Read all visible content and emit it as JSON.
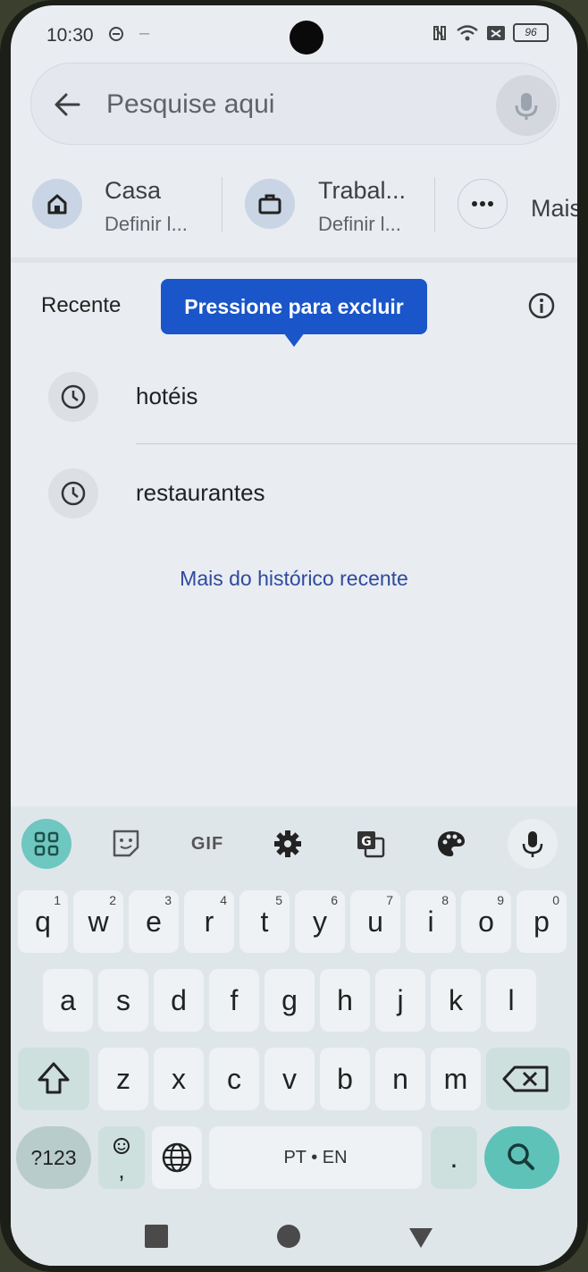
{
  "status_bar": {
    "time": "10:30",
    "battery": "96"
  },
  "search": {
    "placeholder": "Pesquise aqui"
  },
  "shortcuts": [
    {
      "title": "Casa",
      "subtitle": "Definir l..."
    },
    {
      "title": "Trabal...",
      "subtitle": "Definir l..."
    },
    {
      "title": "Mais",
      "subtitle": ""
    }
  ],
  "recent": {
    "label": "Recente",
    "tooltip": "Pressione para excluir",
    "items": [
      "hotéis",
      "restaurantes"
    ],
    "more_link": "Mais do histórico recente"
  },
  "keyboard": {
    "toolbar": {
      "gif": "GIF"
    },
    "row1": [
      "q",
      "w",
      "e",
      "r",
      "t",
      "y",
      "u",
      "i",
      "o",
      "p"
    ],
    "row1_hints": [
      "1",
      "2",
      "3",
      "4",
      "5",
      "6",
      "7",
      "8",
      "9",
      "0"
    ],
    "row2": [
      "a",
      "s",
      "d",
      "f",
      "g",
      "h",
      "j",
      "k",
      "l"
    ],
    "row3": [
      "z",
      "x",
      "c",
      "v",
      "b",
      "n",
      "m"
    ],
    "numsym": "?123",
    "emoji_comma": ",",
    "space": "PT • EN",
    "period": "."
  },
  "colors": {
    "tooltip": "#1a56c9",
    "link": "#2e4a9e",
    "keyboard_accent": "#5fc2b8"
  }
}
